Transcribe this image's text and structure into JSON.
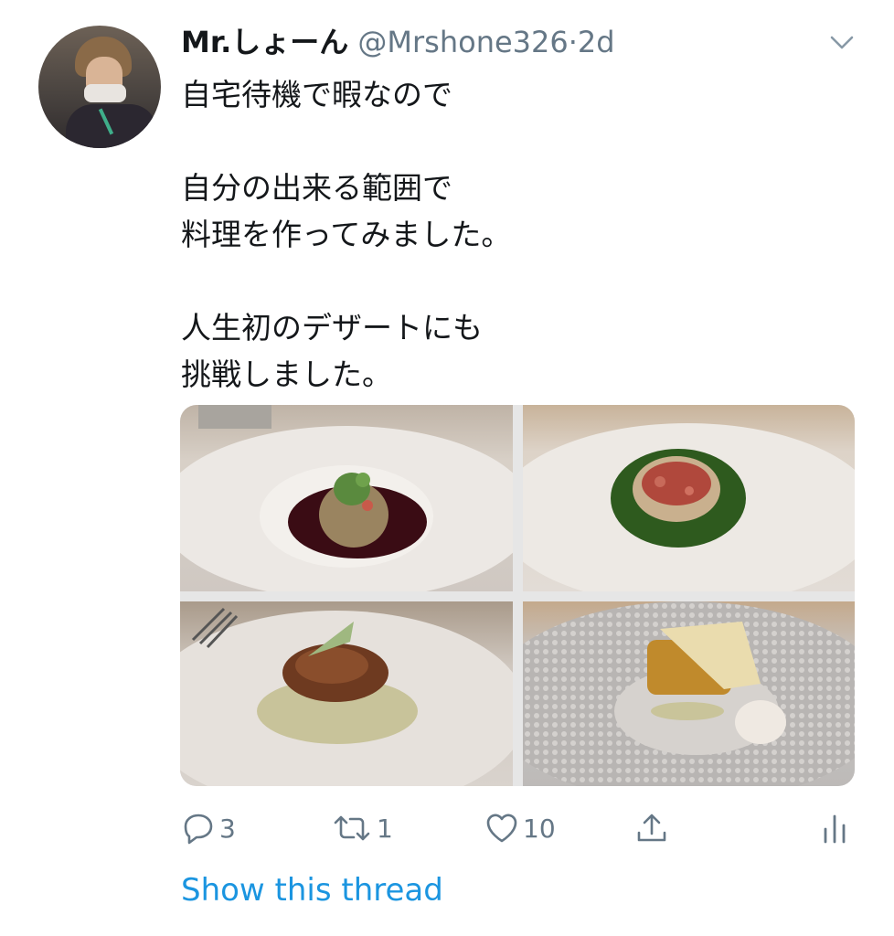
{
  "tweet": {
    "author_name": "Mr.しょーん",
    "author_handle": "@Mrshone326",
    "separator": "·",
    "time": "2d",
    "text_lines": [
      "自宅待機で暇なので",
      "",
      "自分の出来る範囲で",
      "料理を作ってみました。",
      "",
      "人生初のデザートにも",
      "挑戦しました。"
    ],
    "photos": [
      {
        "icon": "pasta-dish-photo"
      },
      {
        "icon": "risotto-dish-photo"
      },
      {
        "icon": "meat-dish-photo"
      },
      {
        "icon": "dessert-dish-photo"
      }
    ]
  },
  "actions": {
    "reply_count": "3",
    "retweet_count": "1",
    "like_count": "10",
    "reply_icon": "reply-icon",
    "retweet_icon": "retweet-icon",
    "like_icon": "heart-icon",
    "share_icon": "share-icon",
    "stats_icon": "analytics-icon"
  },
  "show_thread_label": "Show this thread",
  "colors": {
    "text": "#14171a",
    "secondary": "#657786",
    "link": "#1b95e0",
    "background": "#ffffff"
  }
}
